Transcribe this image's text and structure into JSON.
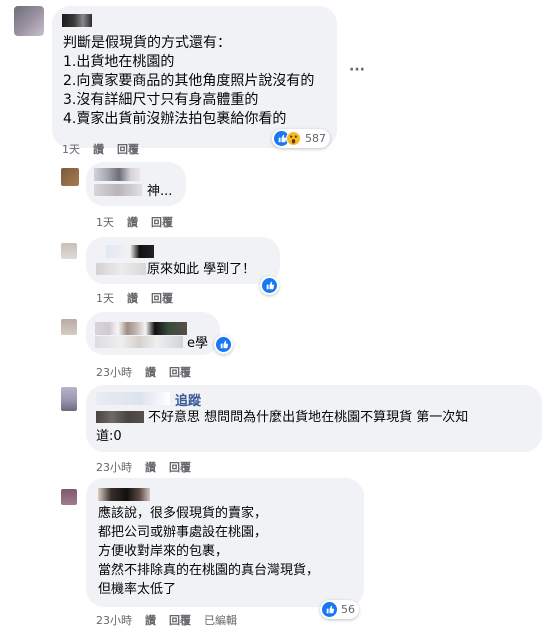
{
  "comments": [
    {
      "lines": [
        "判斷是假現貨的方式還有：",
        "1.出貨地在桃園的",
        "2.向賣家要商品的其他角度照片說沒有的",
        "3.沒有詳細尺寸只有身高體重的",
        "4.賣家出貨前沒辦法拍包裹給你看的"
      ],
      "time": "1天",
      "reply": "讚",
      "respond": "回覆",
      "reaction_count": "587",
      "reaction_icons": [
        "like-icon",
        "wow-icon"
      ]
    },
    {
      "lines": [
        "神..."
      ],
      "time": "1天",
      "reply": "讚",
      "respond": "回覆"
    },
    {
      "lines": [
        "原來如此 學到了！"
      ],
      "time": "1天",
      "reply": "讚",
      "respond": "回覆",
      "reaction_icons": [
        "like-icon"
      ]
    },
    {
      "lines": [
        "e學"
      ],
      "time": "23小時",
      "reply": "讚",
      "respond": "回覆",
      "reaction_icons": [
        "like-icon"
      ]
    },
    {
      "follow_label": "追蹤",
      "lines": [
        "不好意思 想問問為什麼出貨地在桃園不算現貨 第一次知",
        "道:0"
      ],
      "time": "23小時",
      "reply": "讚",
      "respond": "回覆"
    },
    {
      "lines": [
        "應該說，很多假現貨的賣家，",
        "都把公司或辦事處設在桃園，",
        "方便收對岸來的包裹，",
        "當然不排除真的在桃園的真台灣現貨，",
        "但機率太低了"
      ],
      "time": "23小時",
      "reply": "讚",
      "respond": "回覆",
      "edited": "已編輯",
      "reaction_count": "56",
      "reaction_icons": [
        "like-icon"
      ]
    }
  ],
  "more_options": "···",
  "colors": {
    "like": "#1877f2",
    "wow": "#f7b928",
    "bubble": "#f0f2f5",
    "meta": "#65676b"
  }
}
